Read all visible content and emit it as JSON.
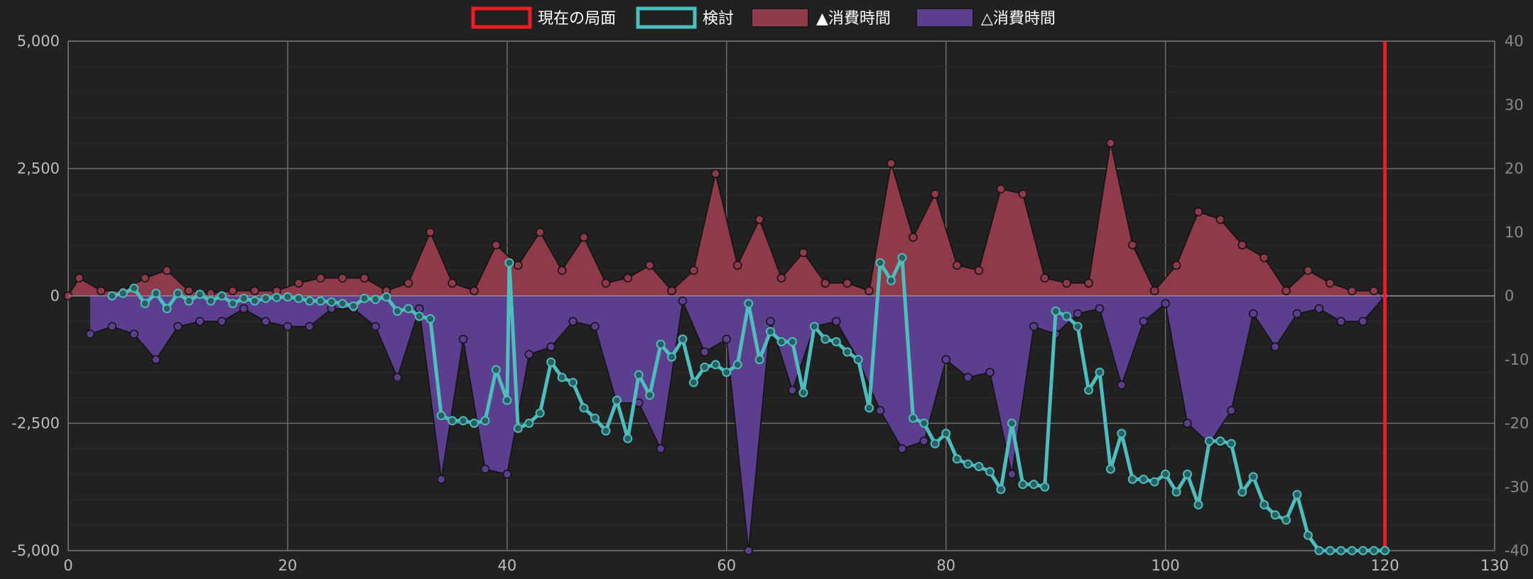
{
  "legend": {
    "current": "現在の局面",
    "eval": "検討",
    "sente_time": "▲消費時間",
    "gote_time": "△消費時間"
  },
  "colors": {
    "background": "#212121",
    "grid": "#4a4a4a",
    "grid_major": "#6e6e6e",
    "current": "#ee1c25",
    "eval": "#4dbdbd",
    "sente_fill": "#8e3a4a",
    "gote_fill": "#5b3e8e"
  },
  "chart_data": {
    "type": "line",
    "x_ticks": [
      "0",
      "20",
      "40",
      "60",
      "80",
      "100",
      "120",
      "130"
    ],
    "y_ticks_left": [
      "5,000",
      "2,500",
      "0",
      "-2,500",
      "-5,000"
    ],
    "y_ticks_right": [
      "40",
      "30",
      "20",
      "10",
      "0",
      "-10",
      "-20",
      "-30",
      "-40"
    ],
    "xlim": [
      0,
      130
    ],
    "ylim_left": [
      -5000,
      5000
    ],
    "ylim_right": [
      -40,
      40
    ],
    "current_move": 120,
    "series": [
      {
        "name": "検討",
        "axis": "left",
        "points": [
          [
            4,
            0
          ],
          [
            5,
            50
          ],
          [
            6,
            150
          ],
          [
            7,
            -150
          ],
          [
            8,
            50
          ],
          [
            9,
            -250
          ],
          [
            10,
            50
          ],
          [
            11,
            -100
          ],
          [
            12,
            30
          ],
          [
            13,
            -100
          ],
          [
            14,
            0
          ],
          [
            15,
            -150
          ],
          [
            16,
            -50
          ],
          [
            17,
            -100
          ],
          [
            18,
            -50
          ],
          [
            19,
            -30
          ],
          [
            20,
            -20
          ],
          [
            21,
            -50
          ],
          [
            22,
            -100
          ],
          [
            23,
            -100
          ],
          [
            24,
            -120
          ],
          [
            25,
            -150
          ],
          [
            26,
            -200
          ],
          [
            27,
            -50
          ],
          [
            28,
            -70
          ],
          [
            29,
            -20
          ],
          [
            30,
            -300
          ],
          [
            31,
            -250
          ],
          [
            32,
            -400
          ],
          [
            33,
            -450
          ],
          [
            34,
            -2350
          ],
          [
            35,
            -2450
          ],
          [
            36,
            -2450
          ],
          [
            37,
            -2500
          ],
          [
            38,
            -2450
          ],
          [
            39,
            -1450
          ],
          [
            40,
            -2050
          ],
          [
            40.2,
            650
          ],
          [
            41,
            -2600
          ],
          [
            42,
            -2500
          ],
          [
            43,
            -2300
          ],
          [
            44,
            -1300
          ],
          [
            45,
            -1600
          ],
          [
            46,
            -1700
          ],
          [
            47,
            -2200
          ],
          [
            48,
            -2400
          ],
          [
            49,
            -2650
          ],
          [
            50,
            -2050
          ],
          [
            51,
            -2800
          ],
          [
            52,
            -1550
          ],
          [
            53,
            -1950
          ],
          [
            54,
            -950
          ],
          [
            55,
            -1200
          ],
          [
            56,
            -850
          ],
          [
            57,
            -1700
          ],
          [
            58,
            -1400
          ],
          [
            59,
            -1350
          ],
          [
            60,
            -1500
          ],
          [
            61,
            -1350
          ],
          [
            62,
            -150
          ],
          [
            63,
            -1250
          ],
          [
            64,
            -700
          ],
          [
            65,
            -900
          ],
          [
            66,
            -900
          ],
          [
            67,
            -1900
          ],
          [
            68,
            -600
          ],
          [
            69,
            -850
          ],
          [
            70,
            -900
          ],
          [
            71,
            -1100
          ],
          [
            72,
            -1250
          ],
          [
            73,
            -2200
          ],
          [
            74,
            650
          ],
          [
            75,
            300
          ],
          [
            76,
            750
          ],
          [
            77,
            -2400
          ],
          [
            78,
            -2500
          ],
          [
            79,
            -2900
          ],
          [
            80,
            -2700
          ],
          [
            81,
            -3200
          ],
          [
            82,
            -3300
          ],
          [
            83,
            -3350
          ],
          [
            84,
            -3450
          ],
          [
            85,
            -3800
          ],
          [
            86,
            -2500
          ],
          [
            87,
            -3700
          ],
          [
            88,
            -3700
          ],
          [
            89,
            -3750
          ],
          [
            90,
            -300
          ],
          [
            91,
            -400
          ],
          [
            92,
            -600
          ],
          [
            93,
            -1850
          ],
          [
            94,
            -1500
          ],
          [
            95,
            -3400
          ],
          [
            96,
            -2700
          ],
          [
            97,
            -3600
          ],
          [
            98,
            -3600
          ],
          [
            99,
            -3650
          ],
          [
            100,
            -3500
          ],
          [
            101,
            -3850
          ],
          [
            102,
            -3500
          ],
          [
            103,
            -4100
          ],
          [
            104,
            -2850
          ],
          [
            105,
            -2850
          ],
          [
            106,
            -2900
          ],
          [
            107,
            -3850
          ],
          [
            108,
            -3550
          ],
          [
            109,
            -4100
          ],
          [
            110,
            -4300
          ],
          [
            111,
            -4400
          ],
          [
            112,
            -3900
          ],
          [
            113,
            -4700
          ],
          [
            114,
            -5000
          ],
          [
            115,
            -5000
          ],
          [
            116,
            -5000
          ],
          [
            117,
            -5000
          ],
          [
            118,
            -5000
          ],
          [
            119,
            -5000
          ],
          [
            120,
            -5000
          ]
        ]
      },
      {
        "name": "▲消費時間",
        "axis": "left",
        "points": [
          [
            0,
            0
          ],
          [
            1,
            350
          ],
          [
            3,
            100
          ],
          [
            5,
            100
          ],
          [
            7,
            350
          ],
          [
            9,
            500
          ],
          [
            11,
            100
          ],
          [
            13,
            50
          ],
          [
            15,
            100
          ],
          [
            17,
            100
          ],
          [
            19,
            100
          ],
          [
            21,
            250
          ],
          [
            23,
            350
          ],
          [
            25,
            350
          ],
          [
            27,
            350
          ],
          [
            29,
            100
          ],
          [
            31,
            250
          ],
          [
            33,
            1250
          ],
          [
            35,
            250
          ],
          [
            37,
            100
          ],
          [
            39,
            1000
          ],
          [
            41,
            600
          ],
          [
            43,
            1250
          ],
          [
            45,
            500
          ],
          [
            47,
            1150
          ],
          [
            49,
            250
          ],
          [
            51,
            350
          ],
          [
            53,
            600
          ],
          [
            55,
            100
          ],
          [
            57,
            500
          ],
          [
            59,
            2400
          ],
          [
            61,
            600
          ],
          [
            63,
            1500
          ],
          [
            65,
            350
          ],
          [
            67,
            850
          ],
          [
            69,
            250
          ],
          [
            71,
            250
          ],
          [
            73,
            100
          ],
          [
            75,
            2600
          ],
          [
            77,
            1150
          ],
          [
            79,
            2000
          ],
          [
            81,
            600
          ],
          [
            83,
            500
          ],
          [
            85,
            2100
          ],
          [
            87,
            2000
          ],
          [
            89,
            350
          ],
          [
            91,
            250
          ],
          [
            93,
            250
          ],
          [
            95,
            3000
          ],
          [
            97,
            1000
          ],
          [
            99,
            100
          ],
          [
            101,
            600
          ],
          [
            103,
            1650
          ],
          [
            105,
            1500
          ],
          [
            107,
            1000
          ],
          [
            109,
            750
          ],
          [
            111,
            100
          ],
          [
            113,
            500
          ],
          [
            115,
            250
          ],
          [
            117,
            100
          ],
          [
            119,
            100
          ],
          [
            120,
            0
          ]
        ]
      },
      {
        "name": "△消費時間",
        "axis": "left",
        "points": [
          [
            2,
            -750
          ],
          [
            4,
            -600
          ],
          [
            6,
            -750
          ],
          [
            8,
            -1250
          ],
          [
            10,
            -600
          ],
          [
            12,
            -500
          ],
          [
            14,
            -500
          ],
          [
            16,
            -250
          ],
          [
            18,
            -500
          ],
          [
            20,
            -600
          ],
          [
            22,
            -600
          ],
          [
            24,
            -250
          ],
          [
            26,
            -250
          ],
          [
            28,
            -600
          ],
          [
            30,
            -1600
          ],
          [
            32,
            -250
          ],
          [
            34,
            -3600
          ],
          [
            36,
            -850
          ],
          [
            38,
            -3400
          ],
          [
            40,
            -3500
          ],
          [
            42,
            -1150
          ],
          [
            44,
            -1000
          ],
          [
            46,
            -500
          ],
          [
            48,
            -600
          ],
          [
            50,
            -2100
          ],
          [
            52,
            -2100
          ],
          [
            54,
            -3000
          ],
          [
            56,
            -100
          ],
          [
            58,
            -1100
          ],
          [
            60,
            -850
          ],
          [
            62,
            -5000
          ],
          [
            64,
            -500
          ],
          [
            66,
            -1850
          ],
          [
            68,
            -600
          ],
          [
            70,
            -500
          ],
          [
            72,
            -1250
          ],
          [
            74,
            -2250
          ],
          [
            76,
            -3000
          ],
          [
            78,
            -2850
          ],
          [
            80,
            -1250
          ],
          [
            82,
            -1600
          ],
          [
            84,
            -1500
          ],
          [
            86,
            -3500
          ],
          [
            88,
            -600
          ],
          [
            90,
            -750
          ],
          [
            92,
            -350
          ],
          [
            94,
            -250
          ],
          [
            96,
            -1750
          ],
          [
            98,
            -500
          ],
          [
            100,
            -150
          ],
          [
            102,
            -2500
          ],
          [
            104,
            -2900
          ],
          [
            106,
            -2250
          ],
          [
            108,
            -350
          ],
          [
            110,
            -1000
          ],
          [
            112,
            -350
          ],
          [
            114,
            -250
          ],
          [
            116,
            -500
          ],
          [
            118,
            -500
          ],
          [
            120,
            0
          ]
        ]
      }
    ]
  }
}
